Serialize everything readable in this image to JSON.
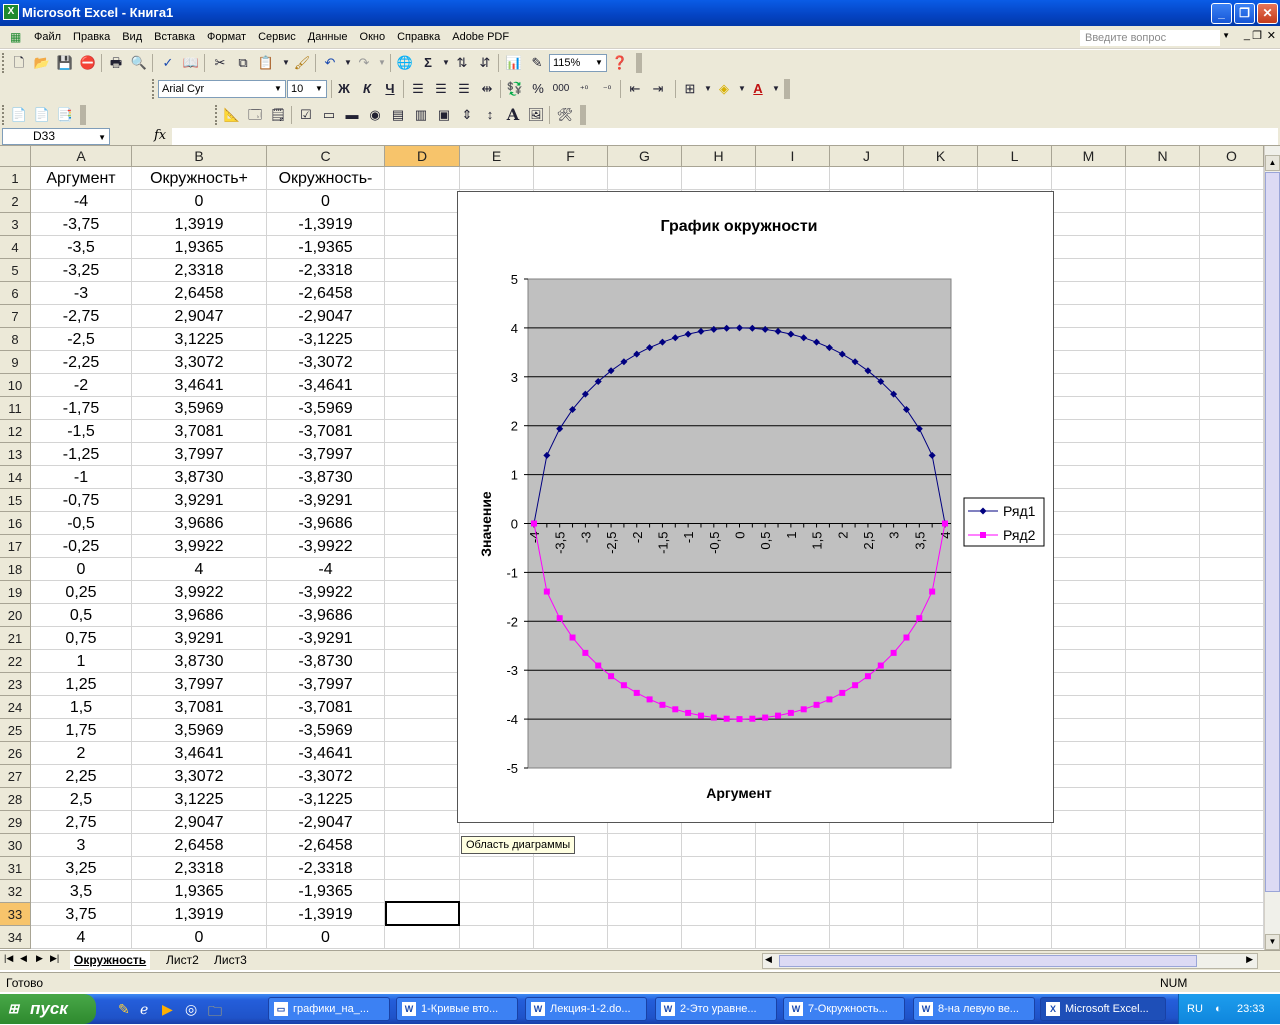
{
  "window": {
    "title": "Microsoft Excel - Книга1",
    "app_icon": "excel-icon"
  },
  "menu": {
    "items": [
      "Файл",
      "Правка",
      "Вид",
      "Вставка",
      "Формат",
      "Сервис",
      "Данные",
      "Окно",
      "Справка",
      "Adobe PDF"
    ],
    "ask_placeholder": "Введите вопрос"
  },
  "toolbar": {
    "zoom": "115%",
    "font_name": "Arial Cyr",
    "font_size": "10",
    "bold": "Ж",
    "italic": "К",
    "underline": "Ч",
    "percent": "%",
    "thousands": "000",
    "sigma": "Σ"
  },
  "formula_bar": {
    "name_box": "D33",
    "fx": "fx",
    "formula": ""
  },
  "grid": {
    "columns": [
      "A",
      "B",
      "C",
      "D",
      "E",
      "F",
      "G",
      "H",
      "I",
      "J",
      "K",
      "L",
      "M",
      "N",
      "O"
    ],
    "selected_column": "D",
    "selected_row": 33,
    "rows": [
      {
        "n": "1",
        "a": "Аргумент",
        "b": "Окружность+",
        "c": "Окружность-"
      },
      {
        "n": "2",
        "a": "-4",
        "b": "0",
        "c": "0"
      },
      {
        "n": "3",
        "a": "-3,75",
        "b": "1,3919",
        "c": "-1,3919"
      },
      {
        "n": "4",
        "a": "-3,5",
        "b": "1,9365",
        "c": "-1,9365"
      },
      {
        "n": "5",
        "a": "-3,25",
        "b": "2,3318",
        "c": "-2,3318"
      },
      {
        "n": "6",
        "a": "-3",
        "b": "2,6458",
        "c": "-2,6458"
      },
      {
        "n": "7",
        "a": "-2,75",
        "b": "2,9047",
        "c": "-2,9047"
      },
      {
        "n": "8",
        "a": "-2,5",
        "b": "3,1225",
        "c": "-3,1225"
      },
      {
        "n": "9",
        "a": "-2,25",
        "b": "3,3072",
        "c": "-3,3072"
      },
      {
        "n": "10",
        "a": "-2",
        "b": "3,4641",
        "c": "-3,4641"
      },
      {
        "n": "11",
        "a": "-1,75",
        "b": "3,5969",
        "c": "-3,5969"
      },
      {
        "n": "12",
        "a": "-1,5",
        "b": "3,7081",
        "c": "-3,7081"
      },
      {
        "n": "13",
        "a": "-1,25",
        "b": "3,7997",
        "c": "-3,7997"
      },
      {
        "n": "14",
        "a": "-1",
        "b": "3,8730",
        "c": "-3,8730"
      },
      {
        "n": "15",
        "a": "-0,75",
        "b": "3,9291",
        "c": "-3,9291"
      },
      {
        "n": "16",
        "a": "-0,5",
        "b": "3,9686",
        "c": "-3,9686"
      },
      {
        "n": "17",
        "a": "-0,25",
        "b": "3,9922",
        "c": "-3,9922"
      },
      {
        "n": "18",
        "a": "0",
        "b": "4",
        "c": "-4"
      },
      {
        "n": "19",
        "a": "0,25",
        "b": "3,9922",
        "c": "-3,9922"
      },
      {
        "n": "20",
        "a": "0,5",
        "b": "3,9686",
        "c": "-3,9686"
      },
      {
        "n": "21",
        "a": "0,75",
        "b": "3,9291",
        "c": "-3,9291"
      },
      {
        "n": "22",
        "a": "1",
        "b": "3,8730",
        "c": "-3,8730"
      },
      {
        "n": "23",
        "a": "1,25",
        "b": "3,7997",
        "c": "-3,7997"
      },
      {
        "n": "24",
        "a": "1,5",
        "b": "3,7081",
        "c": "-3,7081"
      },
      {
        "n": "25",
        "a": "1,75",
        "b": "3,5969",
        "c": "-3,5969"
      },
      {
        "n": "26",
        "a": "2",
        "b": "3,4641",
        "c": "-3,4641"
      },
      {
        "n": "27",
        "a": "2,25",
        "b": "3,3072",
        "c": "-3,3072"
      },
      {
        "n": "28",
        "a": "2,5",
        "b": "3,1225",
        "c": "-3,1225"
      },
      {
        "n": "29",
        "a": "2,75",
        "b": "2,9047",
        "c": "-2,9047"
      },
      {
        "n": "30",
        "a": "3",
        "b": "2,6458",
        "c": "-2,6458"
      },
      {
        "n": "31",
        "a": "3,25",
        "b": "2,3318",
        "c": "-2,3318"
      },
      {
        "n": "32",
        "a": "3,5",
        "b": "1,9365",
        "c": "-1,9365"
      },
      {
        "n": "33",
        "a": "3,75",
        "b": "1,3919",
        "c": "-1,3919"
      },
      {
        "n": "34",
        "a": "4",
        "b": "0",
        "c": "0"
      }
    ]
  },
  "sheets": {
    "tabs": [
      "Окружность",
      "Лист2",
      "Лист3"
    ],
    "active": "Окружность"
  },
  "status": {
    "left": "Готово",
    "num": "NUM"
  },
  "tooltip": "Область диаграммы",
  "taskbar": {
    "start": "пуск",
    "buttons": [
      "графики_на_...",
      "1-Кривые вто...",
      "Лекция-1-2.do...",
      "2-Это уравне...",
      "7-Окружность...",
      "8-на левую ве...",
      "Microsoft Excel..."
    ],
    "lang": "RU",
    "clock": "23:33"
  },
  "colors": {
    "series1": "#000080",
    "series2": "#ff00ff",
    "plot_bg": "#c0c0c0",
    "selected_header": "#f7c46b"
  },
  "chart_data": {
    "type": "line",
    "title": "График окружности",
    "xlabel": "Аргумент",
    "ylabel": "Значение",
    "ylim": [
      -5,
      5
    ],
    "yticks": [
      "5",
      "4",
      "3",
      "2",
      "1",
      "0",
      "-1",
      "-2",
      "-3",
      "-4",
      "-5"
    ],
    "categories": [
      "-4",
      "-3,75",
      "-3,5",
      "-3,25",
      "-3",
      "-2,75",
      "-2,5",
      "-2,25",
      "-2",
      "-1,75",
      "-1,5",
      "-1,25",
      "-1",
      "-0,75",
      "-0,5",
      "-0,25",
      "0",
      "0,25",
      "0,5",
      "0,75",
      "1",
      "1,25",
      "1,5",
      "1,75",
      "2",
      "2,25",
      "2,5",
      "2,75",
      "3",
      "3,25",
      "3,5",
      "3,75",
      "4"
    ],
    "category_labels": [
      "-4",
      "-3,5",
      "-3",
      "-2,5",
      "-2",
      "-1,5",
      "-1",
      "-0,5",
      "0",
      "0,5",
      "1",
      "1,5",
      "2",
      "2,5",
      "3",
      "3,5",
      "4"
    ],
    "series": [
      {
        "name": "Ряд1",
        "values": [
          0,
          1.3919,
          1.9365,
          2.3318,
          2.6458,
          2.9047,
          3.1225,
          3.3072,
          3.4641,
          3.5969,
          3.7081,
          3.7997,
          3.873,
          3.9291,
          3.9686,
          3.9922,
          4,
          3.9922,
          3.9686,
          3.9291,
          3.873,
          3.7997,
          3.7081,
          3.5969,
          3.4641,
          3.3072,
          3.1225,
          2.9047,
          2.6458,
          2.3318,
          1.9365,
          1.3919,
          0
        ]
      },
      {
        "name": "Ряд2",
        "values": [
          0,
          -1.3919,
          -1.9365,
          -2.3318,
          -2.6458,
          -2.9047,
          -3.1225,
          -3.3072,
          -3.4641,
          -3.5969,
          -3.7081,
          -3.7997,
          -3.873,
          -3.9291,
          -3.9686,
          -3.9922,
          -4,
          -3.9922,
          -3.9686,
          -3.9291,
          -3.873,
          -3.7997,
          -3.7081,
          -3.5969,
          -3.4641,
          -3.3072,
          -3.1225,
          -2.9047,
          -2.6458,
          -2.3318,
          -1.9365,
          -1.3919,
          0
        ]
      }
    ],
    "gridlines": true,
    "legend": "right"
  }
}
